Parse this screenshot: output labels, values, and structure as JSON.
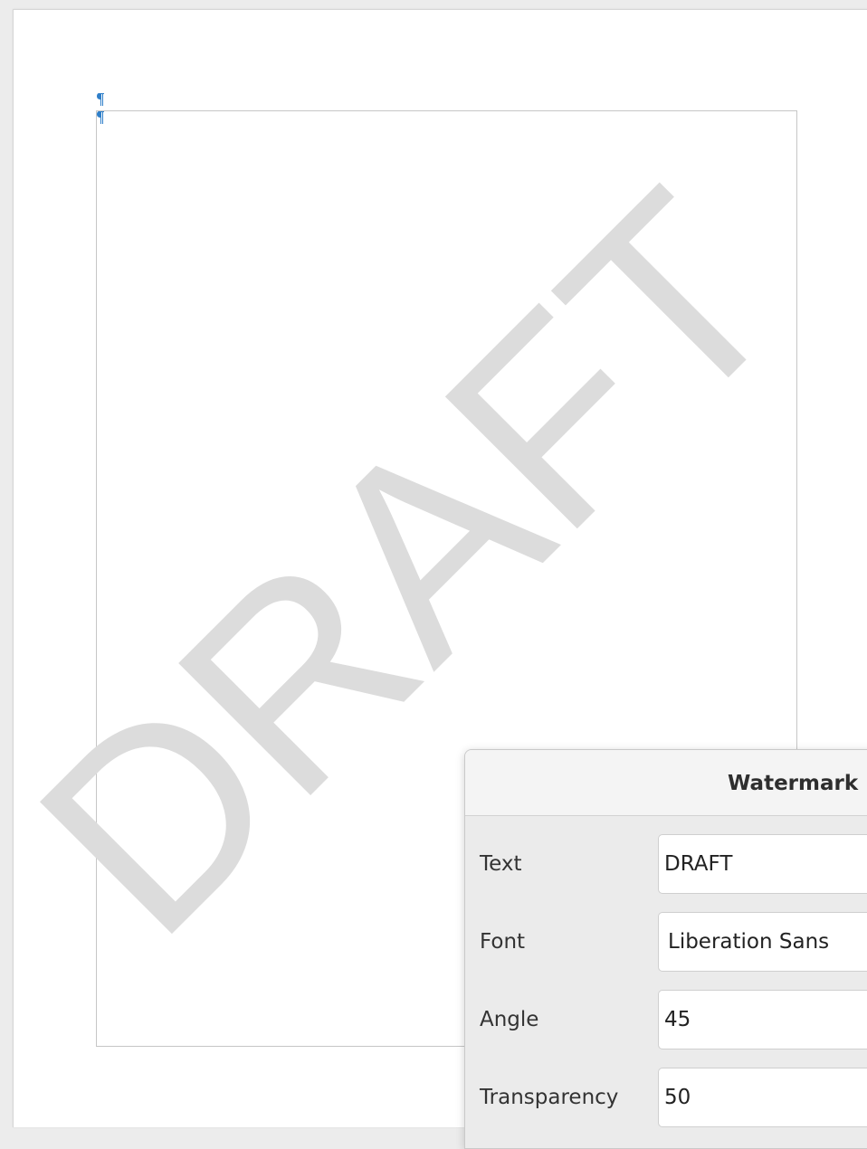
{
  "document": {
    "watermark_text": "DRAFT",
    "watermark_color": "#dcdcdc",
    "pilcrow_color": "#2f7fc9"
  },
  "dialog": {
    "title": "Watermark",
    "fields": [
      {
        "label": "Text",
        "value": "DRAFT"
      },
      {
        "label": "Font",
        "value": "Liberation Sans"
      },
      {
        "label": "Angle",
        "value": "45"
      },
      {
        "label": "Transparency",
        "value": "50"
      }
    ]
  }
}
